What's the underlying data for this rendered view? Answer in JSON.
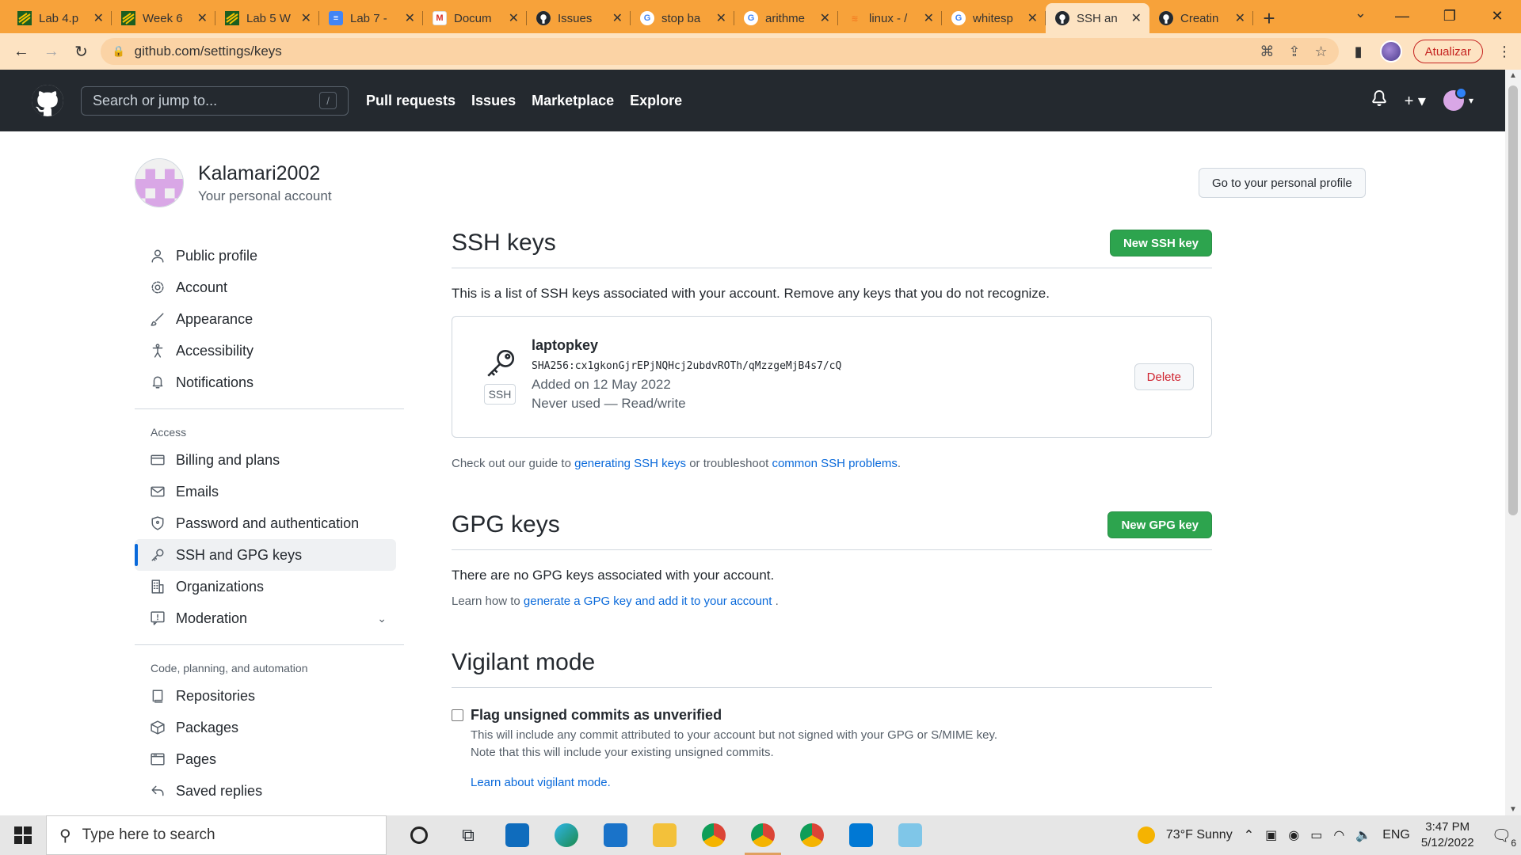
{
  "browser": {
    "tabs": [
      {
        "title": "Lab 4.p",
        "icon": "moodle-icon"
      },
      {
        "title": "Week 6",
        "icon": "moodle-icon"
      },
      {
        "title": "Lab 5 W",
        "icon": "moodle-icon"
      },
      {
        "title": "Lab 7 -",
        "icon": "docs-icon"
      },
      {
        "title": "Docum",
        "icon": "gmail-icon"
      },
      {
        "title": "Issues",
        "icon": "github-icon"
      },
      {
        "title": "stop ba",
        "icon": "google-icon"
      },
      {
        "title": "arithme",
        "icon": "google-icon"
      },
      {
        "title": "linux - /",
        "icon": "stackoverflow-icon"
      },
      {
        "title": "whitesp",
        "icon": "google-icon"
      },
      {
        "title": "SSH an",
        "icon": "github-icon",
        "active": true
      },
      {
        "title": "Creatin",
        "icon": "github-icon"
      }
    ],
    "url": "github.com/settings/keys",
    "update_label": "Atualizar"
  },
  "github": {
    "search_placeholder": "Search or jump to...",
    "search_shortcut": "/",
    "nav": [
      "Pull requests",
      "Issues",
      "Marketplace",
      "Explore"
    ]
  },
  "profile": {
    "username": "Kalamari2002",
    "subtitle": "Your personal account",
    "profile_button": "Go to your personal profile"
  },
  "sidebar": {
    "group1": [
      {
        "label": "Public profile",
        "icon": "person-icon"
      },
      {
        "label": "Account",
        "icon": "gear-icon"
      },
      {
        "label": "Appearance",
        "icon": "paintbrush-icon"
      },
      {
        "label": "Accessibility",
        "icon": "accessibility-icon"
      },
      {
        "label": "Notifications",
        "icon": "bell-icon"
      }
    ],
    "access_heading": "Access",
    "group2": [
      {
        "label": "Billing and plans",
        "icon": "credit-card-icon"
      },
      {
        "label": "Emails",
        "icon": "mail-icon"
      },
      {
        "label": "Password and authentication",
        "icon": "shield-icon"
      },
      {
        "label": "SSH and GPG keys",
        "icon": "key-icon",
        "selected": true
      },
      {
        "label": "Organizations",
        "icon": "organization-icon"
      },
      {
        "label": "Moderation",
        "icon": "report-icon"
      }
    ],
    "code_heading": "Code, planning, and automation",
    "group3": [
      {
        "label": "Repositories",
        "icon": "repo-icon"
      },
      {
        "label": "Packages",
        "icon": "package-icon"
      },
      {
        "label": "Pages",
        "icon": "browser-icon"
      },
      {
        "label": "Saved replies",
        "icon": "reply-icon"
      }
    ]
  },
  "ssh": {
    "title": "SSH keys",
    "new_button": "New SSH key",
    "description": "This is a list of SSH keys associated with your account. Remove any keys that you do not recognize.",
    "key": {
      "name": "laptopkey",
      "badge": "SSH",
      "fingerprint": "SHA256:cx1gkonGjrEPjNQHcj2ubdvROTh/qMzzgeMjB4s7/cQ",
      "added": "Added on 12 May 2022",
      "usage": "Never used — Read/write",
      "delete_label": "Delete"
    },
    "guide_prefix": "Check out our guide to ",
    "guide_link1": "generating SSH keys",
    "guide_middle": " or troubleshoot ",
    "guide_link2": "common SSH problems",
    "guide_suffix": "."
  },
  "gpg": {
    "title": "GPG keys",
    "new_button": "New GPG key",
    "empty_text": "There are no GPG keys associated with your account.",
    "learn_prefix": "Learn how to ",
    "learn_link": "generate a GPG key and add it to your account",
    "learn_suffix": " ."
  },
  "vigilant": {
    "title": "Vigilant mode",
    "checkbox_label": "Flag unsigned commits as unverified",
    "checked": false,
    "desc_line1": "This will include any commit attributed to your account but not signed with your GPG or S/MIME key.",
    "desc_line2": "Note that this will include your existing unsigned commits.",
    "learn_link": "Learn about vigilant mode."
  },
  "taskbar": {
    "search_placeholder": "Type here to search",
    "weather": "73°F  Sunny",
    "language": "ENG",
    "time": "3:47 PM",
    "date": "5/12/2022",
    "notification_count": "6"
  },
  "colors": {
    "tabstrip": "#f7a23a",
    "github_header": "#24292f",
    "primary_button": "#2da44e",
    "link": "#0969da",
    "danger": "#cf222e"
  }
}
